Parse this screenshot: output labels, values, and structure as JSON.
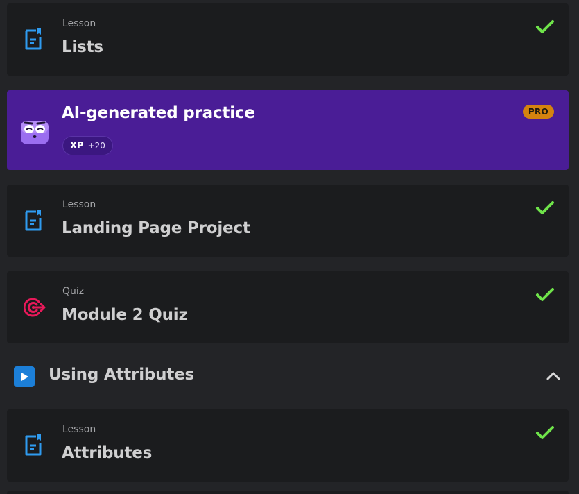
{
  "items": [
    {
      "kind": "Lesson",
      "title": "Lists",
      "icon": "lesson-doc-icon",
      "completed": true
    },
    {
      "kind": "Lesson",
      "title": "Landing Page Project",
      "icon": "lesson-doc-icon",
      "completed": true
    },
    {
      "kind": "Quiz",
      "title": "Module 2 Quiz",
      "icon": "quiz-target-icon",
      "completed": true
    }
  ],
  "practice": {
    "title": "AI-generated practice",
    "xp_label": "XP",
    "xp_amount": "+20",
    "badge": "PRO",
    "icon": "mascot-icon"
  },
  "section": {
    "title": "Using Attributes",
    "icon": "play-icon",
    "expanded": true
  },
  "section_items": [
    {
      "kind": "Lesson",
      "title": "Attributes",
      "icon": "lesson-doc-icon",
      "completed": true
    }
  ],
  "colors": {
    "card_bg": "#1b1c1e",
    "page_bg": "#232427",
    "practice_bg": "#4a1d96",
    "check_green": "#6fe34a",
    "lesson_blue": "#2f9bf0",
    "quiz_pink": "#e8195a",
    "pro_orange": "#d4830f"
  }
}
